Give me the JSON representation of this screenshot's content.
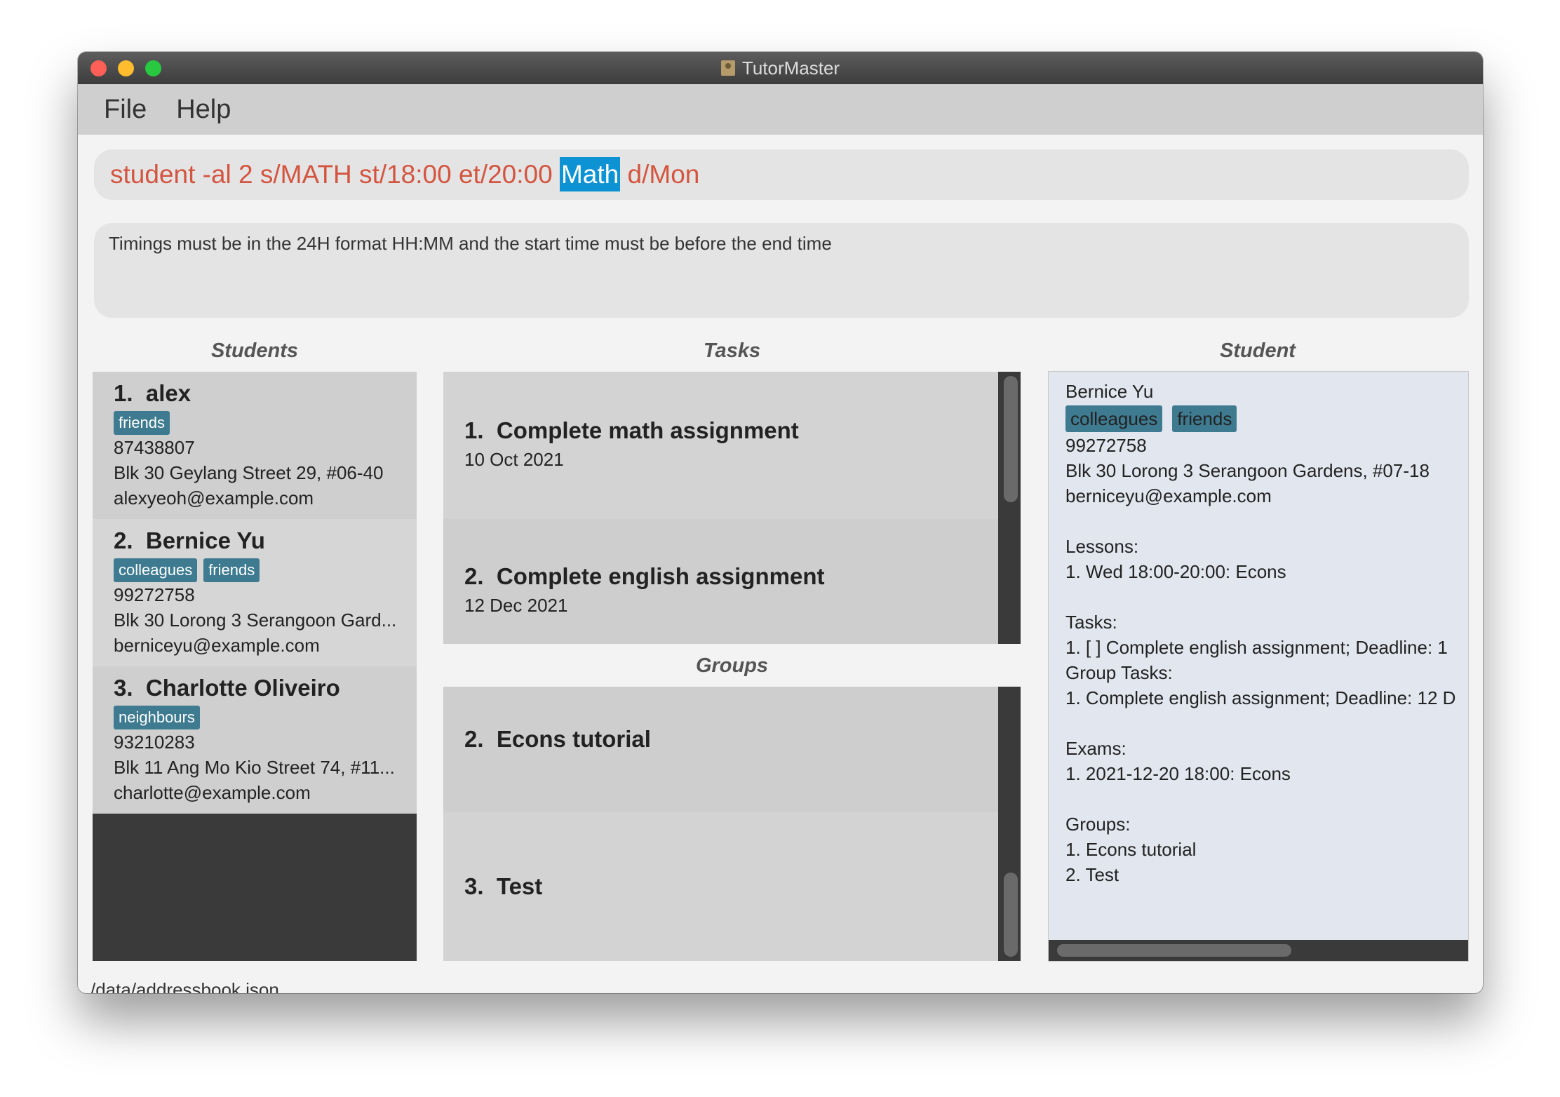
{
  "window": {
    "title": "TutorMaster"
  },
  "menu": {
    "items": [
      "File",
      "Help"
    ]
  },
  "command": {
    "before": "student -al 2 s/MATH st/18:00 et/20:00 ",
    "selected": "Math",
    "after": " d/Mon"
  },
  "result": {
    "message": "Timings must be in the 24H format HH:MM and the start time must be before the end time"
  },
  "columns": {
    "students": "Students",
    "tasks": "Tasks",
    "groups": "Groups",
    "student": "Student"
  },
  "students": [
    {
      "index": "1.",
      "name": "alex",
      "tags": [
        "friends"
      ],
      "phone": "87438807",
      "address": "Blk 30 Geylang Street 29, #06-40",
      "email": "alexyeoh@example.com"
    },
    {
      "index": "2.",
      "name": "Bernice Yu",
      "tags": [
        "colleagues",
        "friends"
      ],
      "phone": "99272758",
      "address": "Blk 30 Lorong 3 Serangoon Gard...",
      "email": "berniceyu@example.com"
    },
    {
      "index": "3.",
      "name": "Charlotte Oliveiro",
      "tags": [
        "neighbours"
      ],
      "phone": "93210283",
      "address": "Blk 11 Ang Mo Kio Street 74, #11...",
      "email": "charlotte@example.com"
    }
  ],
  "tasks": [
    {
      "index": "1.",
      "title": "Complete math assignment",
      "date": "10 Oct 2021"
    },
    {
      "index": "2.",
      "title": "Complete english assignment",
      "date": "12 Dec 2021"
    }
  ],
  "groups": [
    {
      "index": "2.",
      "title": "Econs tutorial"
    },
    {
      "index": "3.",
      "title": "Test"
    }
  ],
  "detail": {
    "name": "Bernice Yu",
    "tags": [
      "colleagues",
      "friends"
    ],
    "phone": "99272758",
    "address": "Blk 30 Lorong 3 Serangoon Gardens, #07-18",
    "email": "berniceyu@example.com",
    "lessons_header": "Lessons:",
    "lessons": "1. Wed 18:00-20:00: Econs",
    "tasks_header": "Tasks:",
    "tasks": "1. [ ] Complete english assignment; Deadline: 1",
    "group_tasks_header": "Group Tasks:",
    "group_tasks": "1. Complete english assignment; Deadline: 12 D",
    "exams_header": "Exams:",
    "exams": "1. 2021-12-20 18:00: Econs",
    "groups_header": "Groups:",
    "groups": [
      "1. Econs tutorial",
      "2. Test"
    ]
  },
  "status": {
    "file": "/data/addressbook.json"
  }
}
